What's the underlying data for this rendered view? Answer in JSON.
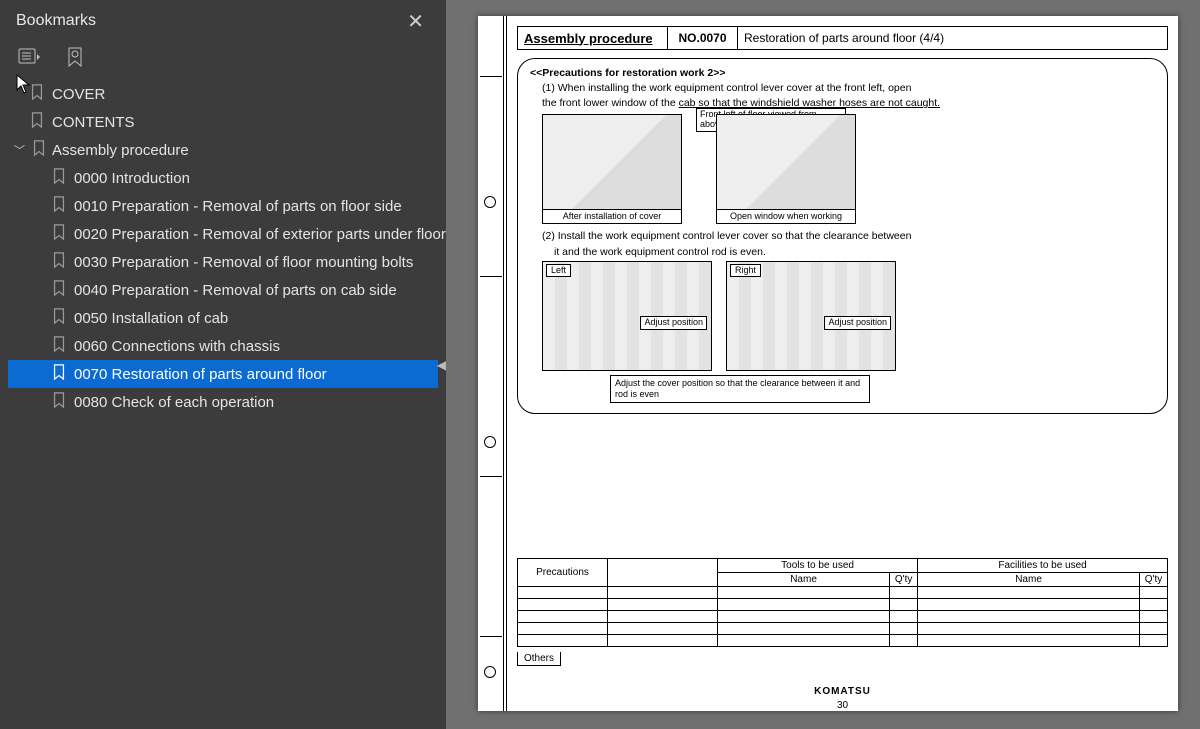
{
  "sidebar": {
    "title": "Bookmarks",
    "close_glyph": "✕",
    "items_top": [
      {
        "label": "COVER"
      },
      {
        "label": "CONTENTS"
      }
    ],
    "parent": {
      "label": "Assembly procedure",
      "expanded": true
    },
    "children": [
      {
        "label": "0000 Introduction"
      },
      {
        "label": "0010 Preparation - Removal of parts on floor side"
      },
      {
        "label": "0020 Preparation - Removal of exterior parts under floor"
      },
      {
        "label": "0030 Preparation - Removal of floor mounting bolts"
      },
      {
        "label": "0040 Preparation - Removal of parts on cab side"
      },
      {
        "label": "0050 Installation of cab"
      },
      {
        "label": "0060 Connections with chassis"
      },
      {
        "label": "0070 Restoration of parts around floor",
        "selected": true
      },
      {
        "label": "0080 Check of each operation"
      }
    ]
  },
  "doc": {
    "header": {
      "title": "Assembly procedure",
      "no": "NO.0070",
      "desc": "Restoration of parts around floor (4/4)"
    },
    "section_title": "<<Precautions for restoration work 2>>",
    "note1_a": "(1) When installing the work equipment control lever cover at the front left, open",
    "note1_b": "the front lower window of the ",
    "note1_c": "cab so that the windshield washer hoses are not caught.",
    "callout1": "Front left of floor viewed from above diagonally",
    "fig1_cap": "After installation of cover",
    "fig2_cap": "Open window when working",
    "note2_a": "(2) Install the work equipment control lever cover so that the clearance between",
    "note2_b": "it and the work equipment control rod is even.",
    "tag_left": "Left",
    "tag_right": "Right",
    "adjust": "Adjust position",
    "wide_note": "Adjust the cover position so that the clearance between it and rod is even",
    "table": {
      "precautions": "Precautions",
      "tools": "Tools to be used",
      "facilities": "Facilities to be used",
      "name": "Name",
      "qty": "Q'ty",
      "others": "Others"
    },
    "brand": "KOMATSU",
    "page_number": "30"
  }
}
